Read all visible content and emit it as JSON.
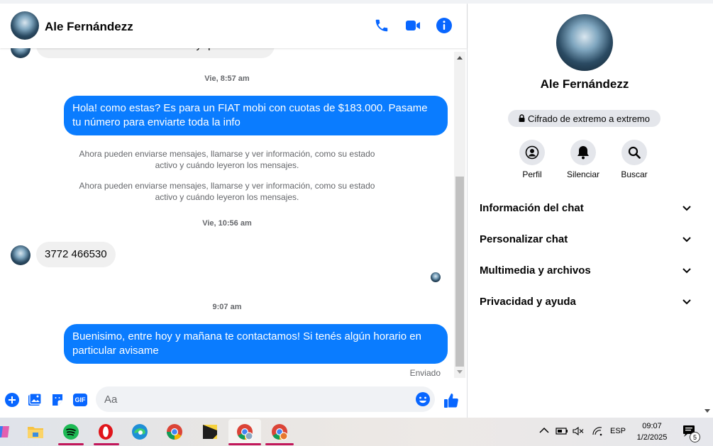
{
  "contact": {
    "name": "Ale Fernándezz"
  },
  "header": {
    "call_icon": "phone-icon",
    "video_icon": "video-icon",
    "info_icon": "info-icon"
  },
  "messages": {
    "partial_incoming": "Hola de cuanto seria las cuotas y que dato son",
    "ts1": "Vie, 8:57 am",
    "out1": "Hola! como estas? Es para un FIAT mobi con cuotas de $183.000. Pasame tu número para enviarte toda la info",
    "sys1": "Ahora pueden enviarse mensajes, llamarse y ver información, como su estado activo y cuándo leyeron los mensajes.",
    "sys2": "Ahora pueden enviarse mensajes, llamarse y ver información, como su estado activo y cuándo leyeron los mensajes.",
    "ts2": "Vie, 10:56 am",
    "in1": "3772 466530",
    "ts3": "9:07 am",
    "out2": "Buenisimo, entre hoy y mañana te contactamos! Si tenés algún horario en particular avisame",
    "status": "Enviado"
  },
  "composer": {
    "placeholder": "Aa",
    "icons": [
      "plus-icon",
      "image-icon",
      "sticker-icon",
      "gif-icon",
      "emoji-icon",
      "like-icon"
    ],
    "gif_label": "GIF"
  },
  "info_panel": {
    "name": "Ale Fernándezz",
    "e2e": "Cifrado de extremo a extremo",
    "actions": [
      {
        "label": "Perfil",
        "icon": "profile-icon"
      },
      {
        "label": "Silenciar",
        "icon": "bell-icon"
      },
      {
        "label": "Buscar",
        "icon": "search-icon"
      }
    ],
    "sections": [
      "Información del chat",
      "Personalizar chat",
      "Multimedia y archivos",
      "Privacidad y ayuda"
    ]
  },
  "taskbar": {
    "apps": [
      "copilot-icon",
      "file-explorer-icon",
      "spotify-icon",
      "opera-icon",
      "edge-icon",
      "chrome-icon",
      "sticky-notes-icon",
      "chrome-profile-icon",
      "chrome-profile-2-icon"
    ],
    "language": "ESP",
    "time": "09:07",
    "date": "1/2/2025",
    "notifications": "5"
  },
  "colors": {
    "accent": "#0a7cff",
    "messenger_blue": "#0866ff",
    "bubble_in": "#f0f0f0"
  }
}
